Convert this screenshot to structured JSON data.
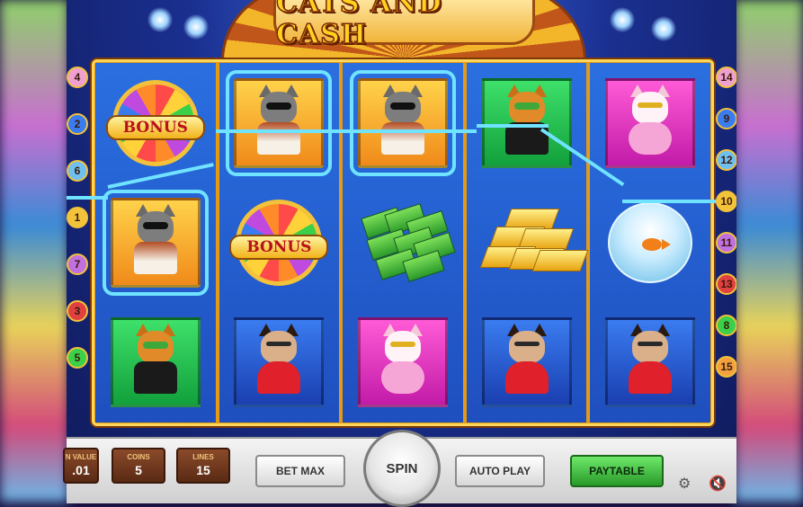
{
  "game": {
    "title": "CATS AND CASH"
  },
  "reels": [
    [
      {
        "symbol": "bonus-wheel",
        "label": "BONUS",
        "bg": "none"
      },
      {
        "symbol": "gray-cat",
        "bg": "orange",
        "win": true
      },
      {
        "symbol": "tabby-cat",
        "bg": "green"
      }
    ],
    [
      {
        "symbol": "gray-cat",
        "bg": "orange",
        "win": true
      },
      {
        "symbol": "bonus-wheel",
        "label": "BONUS",
        "bg": "none"
      },
      {
        "symbol": "lady-cat",
        "bg": "blue"
      }
    ],
    [
      {
        "symbol": "gray-cat",
        "bg": "orange",
        "win": true
      },
      {
        "symbol": "cash-stack",
        "bg": "none"
      },
      {
        "symbol": "fluffy-cat",
        "bg": "magenta"
      }
    ],
    [
      {
        "symbol": "tabby-cat",
        "bg": "green"
      },
      {
        "symbol": "gold-bars",
        "bg": "none"
      },
      {
        "symbol": "lady-cat",
        "bg": "blue"
      }
    ],
    [
      {
        "symbol": "fluffy-cat",
        "bg": "magenta"
      },
      {
        "symbol": "fishbowl",
        "bg": "none"
      },
      {
        "symbol": "lady-cat",
        "bg": "blue"
      }
    ]
  ],
  "paylines_left": [
    "4",
    "2",
    "6",
    "1",
    "7",
    "3",
    "5"
  ],
  "paylines_right": [
    "14",
    "9",
    "12",
    "10",
    "11",
    "13",
    "8",
    "15"
  ],
  "controls": {
    "coin_value_label": "N VALUE",
    "coin_value": ".01",
    "coins_label": "COINS",
    "coins": "5",
    "lines_label": "LINES",
    "lines": "15",
    "bet_max": "BET MAX",
    "spin": "SPIN",
    "auto_play": "AUTO PLAY",
    "paytable": "PAYTABLE"
  },
  "icons": {
    "settings": "gear-icon",
    "sound": "speaker-muted-icon"
  }
}
